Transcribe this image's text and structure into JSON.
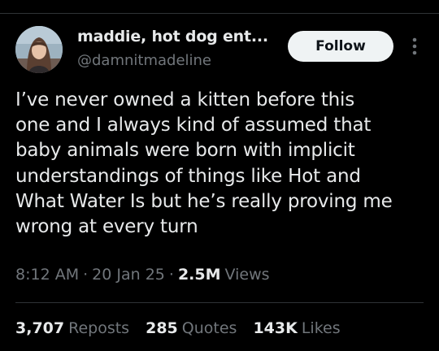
{
  "author": {
    "display_name": "maddie, hot dog ent...",
    "handle": "@damnitmadeline",
    "avatar_icon": "profile-photo"
  },
  "follow_button": {
    "label": "Follow"
  },
  "more_icon": "three-dots-vertical-icon",
  "tweet": {
    "lines": [
      "I’ve never owned a kitten before this",
      "one and I always kind of assumed that",
      "baby animals were born with implicit",
      "understandings of things like Hot and",
      "What Water Is but he’s really proving me",
      "wrong at every turn"
    ]
  },
  "meta": {
    "time": "8:12 AM",
    "separator": "·",
    "date": "20 Jan 25",
    "views_count": "2.5M",
    "views_label": "Views"
  },
  "stats": {
    "reposts": {
      "count": "3,707",
      "label": "Reposts"
    },
    "quotes": {
      "count": "285",
      "label": "Quotes"
    },
    "likes": {
      "count": "143K",
      "label": "Likes"
    }
  },
  "colors": {
    "background": "#000000",
    "primary_text": "#e7e9ea",
    "secondary_text": "#71767b",
    "divider": "#2f3336",
    "follow_bg": "#eff3f4",
    "follow_text": "#0f1419"
  }
}
